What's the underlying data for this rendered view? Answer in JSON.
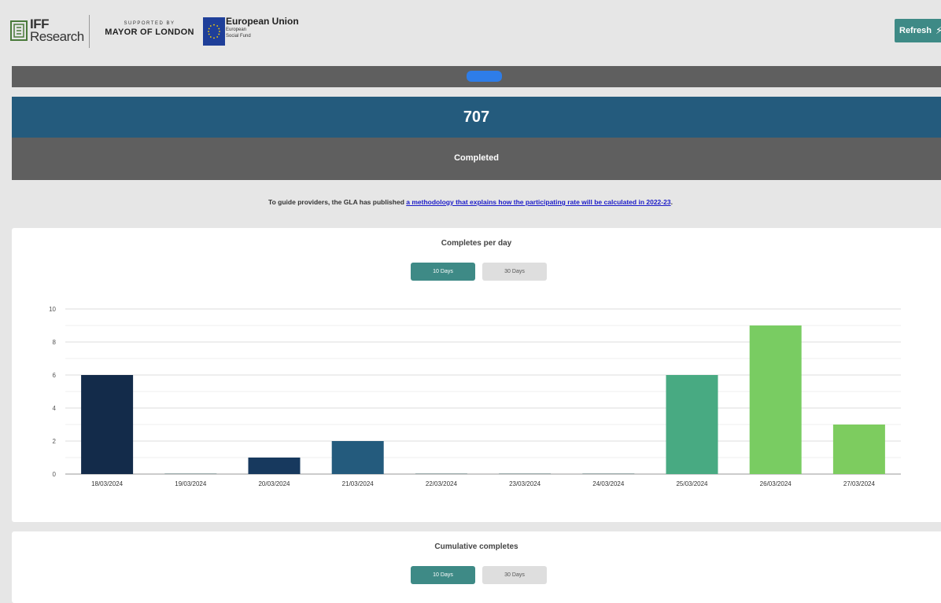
{
  "header": {
    "iff_line1": "IFF",
    "iff_line2": "Research",
    "supported_by": "SUPPORTED BY",
    "mayor": "MAYOR OF LONDON",
    "eu_title": "European Union",
    "eu_line1": "European",
    "eu_line2": "Social Fund",
    "refresh_label": "Refresh"
  },
  "summary": {
    "count": "707",
    "status": "Completed"
  },
  "guide": {
    "prefix": "To guide providers, the GLA has published ",
    "link_text": "a methodology that explains how the participating rate will be calculated in 2022-23",
    "suffix": "."
  },
  "card1": {
    "title": "Completes per day",
    "toggle_active": "10 Days",
    "toggle_inactive": "30 Days"
  },
  "card2": {
    "title": "Cumulative completes",
    "toggle_active": "10 Days",
    "toggle_inactive": "30 Days"
  },
  "chart_data": {
    "type": "bar",
    "title": "Completes per day",
    "categories": [
      "18/03/2024",
      "19/03/2024",
      "20/03/2024",
      "21/03/2024",
      "22/03/2024",
      "23/03/2024",
      "24/03/2024",
      "25/03/2024",
      "26/03/2024",
      "27/03/2024"
    ],
    "values": [
      6,
      0,
      1,
      2,
      0,
      0,
      0,
      6,
      9,
      3
    ],
    "colors": [
      "#132b4a",
      "#132b4a",
      "#17395e",
      "#245b7d",
      "#2a6a86",
      "#2f7a8a",
      "#3a8f88",
      "#48aa82",
      "#79cc62",
      "#7dcc5f"
    ],
    "ylim": [
      0,
      10
    ],
    "yticks": [
      0,
      2,
      4,
      6,
      8,
      10
    ],
    "grid": true,
    "xlabel": "",
    "ylabel": ""
  },
  "colors": {
    "accent": "#3e8a86",
    "count_bar": "#245b7d",
    "grey_bar": "#5f5f5f",
    "link": "#1b1bc8"
  }
}
